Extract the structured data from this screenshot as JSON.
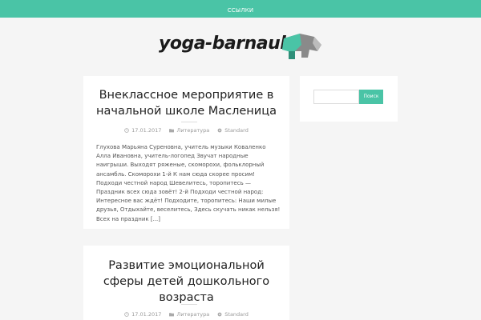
{
  "nav": {
    "links_label": "ССЫЛКИ"
  },
  "site": {
    "logo_text": "yoga-barnaul"
  },
  "colors": {
    "accent": "#4ac4a6",
    "logo_gray": "#8a8a8a"
  },
  "posts": [
    {
      "title": "Внеклассное мероприятие в начальной школе Масленица",
      "date": "17.01.2017",
      "category": "Литература",
      "format": "Standard",
      "excerpt": "Глухова Марьяна Суреновна, учитель музыки Коваленко Алла Ивановна, учитель-логопед Звучат народные наигрыши. Выходят ряженые, скоморохи, фольклорный ансамбль. Скоморохи 1-й К нам сюда скорее просим! Подходи честной народ Шевелитесь, торопитесь — Праздник всех сюда зовёт! 2-й Подходи честной народ: Интересное вас ждёт! Подходите, торопитесь: Наши милые друзья, Отдыхайте, веселитесь, Здесь скучать никак нельзя! Всех на праздник [...]"
    },
    {
      "title": "Развитие эмоциональной сферы детей дошкольного возраста",
      "date": "17.01.2017",
      "category": "Литература",
      "format": "Standard"
    }
  ],
  "search": {
    "button_label": "Поиск",
    "value": ""
  }
}
